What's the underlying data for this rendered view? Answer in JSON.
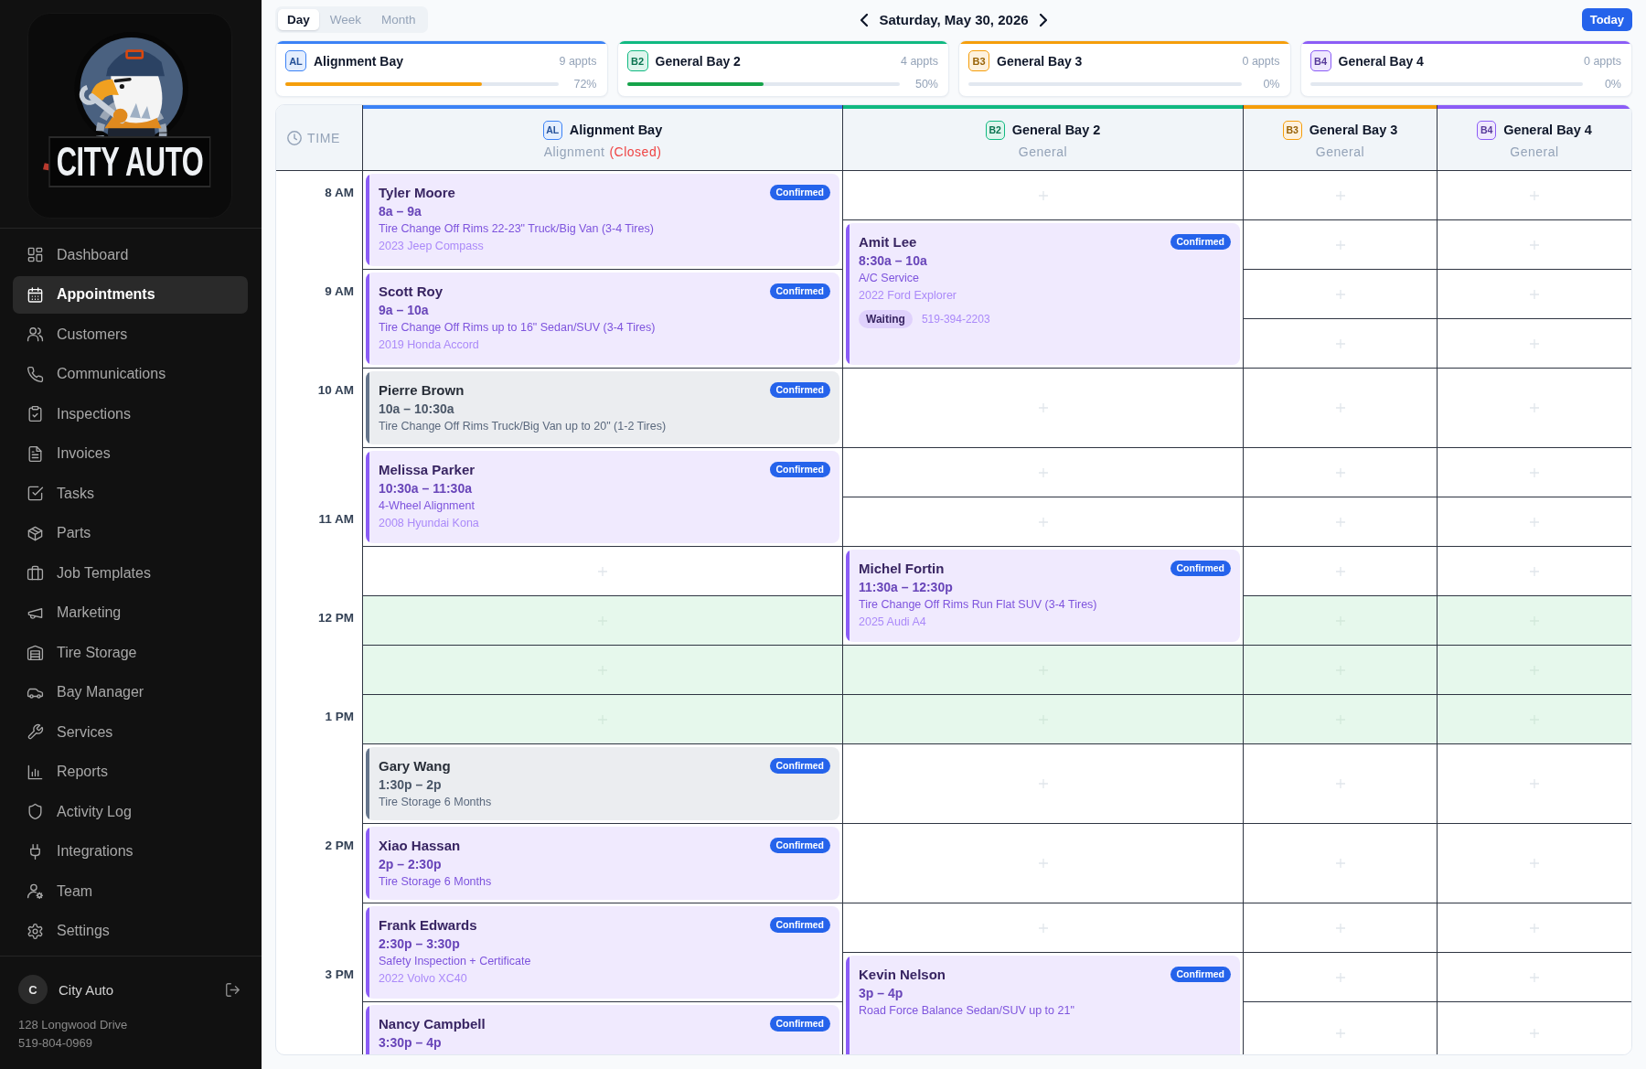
{
  "sidebar": {
    "logo": {
      "text": "CITY AUTO"
    },
    "nav": [
      {
        "label": "Dashboard",
        "selected": false
      },
      {
        "label": "Appointments",
        "selected": true
      },
      {
        "label": "Customers",
        "selected": false
      },
      {
        "label": "Communications",
        "selected": false
      },
      {
        "label": "Inspections",
        "selected": false
      },
      {
        "label": "Invoices",
        "selected": false
      },
      {
        "label": "Tasks",
        "selected": false
      },
      {
        "label": "Parts",
        "selected": false
      },
      {
        "label": "Job Templates",
        "selected": false
      },
      {
        "label": "Marketing",
        "selected": false
      },
      {
        "label": "Tire Storage",
        "selected": false
      },
      {
        "label": "Bay Manager",
        "selected": false
      },
      {
        "label": "Services",
        "selected": false
      },
      {
        "label": "Reports",
        "selected": false
      },
      {
        "label": "Activity Log",
        "selected": false
      },
      {
        "label": "Integrations",
        "selected": false
      },
      {
        "label": "Team",
        "selected": false
      },
      {
        "label": "Settings",
        "selected": false
      }
    ],
    "account": {
      "avatar": "C",
      "name": "City Auto",
      "address": "128 Longwood Drive",
      "phone": "519-804-0969"
    }
  },
  "toolbar": {
    "views": [
      {
        "label": "Day",
        "selected": true
      },
      {
        "label": "Week",
        "selected": false
      },
      {
        "label": "Month",
        "selected": false
      }
    ],
    "date": "Saturday, May 30, 2026",
    "today_button": "Today"
  },
  "bay_summary": [
    {
      "code": "AL",
      "name": "Alignment Bay",
      "appts": "9 appts",
      "level": 0.72,
      "percent": "72%",
      "color": "#3b82f6"
    },
    {
      "code": "B2",
      "name": "General Bay 2",
      "appts": "4 appts",
      "level": 0.5,
      "percent": "50%",
      "color": "#10b981"
    },
    {
      "code": "B3",
      "name": "General Bay 3",
      "appts": "0 appts",
      "level": 0,
      "percent": "0%",
      "color": "#f59e0b"
    },
    {
      "code": "B4",
      "name": "General Bay 4",
      "appts": "0 appts",
      "level": 0,
      "percent": "0%",
      "color": "#8b5cf6"
    }
  ],
  "schedule": {
    "time_header": "TIME",
    "time_slots": [
      {
        "label": "8 AM",
        "lunch": false
      },
      {
        "lunch": false
      },
      {
        "label": "9 AM",
        "lunch": false
      },
      {
        "lunch": false
      },
      {
        "label": "10 AM",
        "lunch": false
      },
      {
        "lunch": false
      },
      {
        "label": "11 AM",
        "lunch": false
      },
      {
        "lunch": false
      },
      {
        "label": "12 PM",
        "lunch": true
      },
      {
        "lunch": true
      },
      {
        "label": "1 PM",
        "lunch": true
      },
      {
        "lunch": false
      },
      {
        "label": "2 PM",
        "lunch": false
      },
      {
        "lunch": false
      },
      {
        "label": "3 PM",
        "lunch": false
      },
      {
        "lunch": false
      }
    ],
    "columns": [
      {
        "code": "AL",
        "name": "Alignment Bay",
        "type": "Alignment",
        "status": "(Closed)",
        "color": "#3b82f6",
        "slots": [
          {
            "kind": "appointment",
            "customer": "Tyler Moore",
            "time": "8a – 9a",
            "service": "Tire Change Off Rims 22-23\" Truck/Big Van (3-4 Tires)",
            "vehicle": "2023 Jeep Compass",
            "status": "Confirmed",
            "color": "#8b5cf6"
          },
          {
            "kind": "continued"
          },
          {
            "kind": "appointment",
            "customer": "Scott Roy",
            "time": "9a – 10a",
            "service": "Tire Change Off Rims up to 16\" Sedan/SUV (3-4 Tires)",
            "vehicle": "2019 Honda Accord",
            "status": "Confirmed",
            "color": "#8b5cf6"
          },
          {
            "kind": "continued"
          },
          {
            "kind": "appointment",
            "customer": "Pierre Brown",
            "time": "10a – 10:30a",
            "service": "Tire Change Off Rims Truck/Big Van up to 20\" (1-2 Tires)",
            "status": "Confirmed",
            "color": "#64748b"
          },
          {
            "kind": "appointment",
            "customer": "Melissa Parker",
            "time": "10:30a – 11:30a",
            "service": "4-Wheel Alignment",
            "vehicle": "2008 Hyundai Kona",
            "status": "Confirmed",
            "color": "#8b5cf6"
          },
          {
            "kind": "continued"
          },
          {
            "kind": "empty"
          },
          {
            "kind": "empty"
          },
          {
            "kind": "empty"
          },
          {
            "kind": "empty"
          },
          {
            "kind": "appointment",
            "customer": "Gary Wang",
            "time": "1:30p – 2p",
            "service": "Tire Storage 6 Months",
            "status": "Confirmed",
            "color": "#64748b"
          },
          {
            "kind": "appointment",
            "customer": "Xiao Hassan",
            "time": "2p – 2:30p",
            "service": "Tire Storage 6 Months",
            "status": "Confirmed",
            "color": "#8b5cf6"
          },
          {
            "kind": "appointment",
            "customer": "Frank Edwards",
            "time": "2:30p – 3:30p",
            "service": "Safety Inspection + Certificate",
            "vehicle": "2022 Volvo XC40",
            "status": "Confirmed",
            "color": "#8b5cf6"
          },
          {
            "kind": "continued"
          },
          {
            "kind": "appointment",
            "customer": "Nancy Campbell",
            "time": "3:30p – 4p",
            "status": "Confirmed",
            "color": "#8b5cf6"
          }
        ]
      },
      {
        "code": "B2",
        "name": "General Bay 2",
        "type": "General",
        "color": "#10b981",
        "slots": [
          {
            "kind": "empty"
          },
          {
            "kind": "appointment",
            "customer": "Amit Lee",
            "time": "8:30a – 10a",
            "service": "A/C Service",
            "vehicle": "2022 Ford Explorer",
            "tag": "Waiting",
            "phone": "519-394-2203",
            "status": "Confirmed",
            "color": "#8b5cf6"
          },
          {
            "kind": "continued"
          },
          {
            "kind": "continued"
          },
          {
            "kind": "empty"
          },
          {
            "kind": "empty"
          },
          {
            "kind": "empty"
          },
          {
            "kind": "appointment",
            "customer": "Michel Fortin",
            "time": "11:30a – 12:30p",
            "service": "Tire Change Off Rims Run Flat SUV (3-4 Tires)",
            "vehicle": "2025 Audi A4",
            "status": "Confirmed",
            "color": "#8b5cf6"
          },
          {
            "kind": "continued"
          },
          {
            "kind": "empty"
          },
          {
            "kind": "empty"
          },
          {
            "kind": "empty"
          },
          {
            "kind": "empty"
          },
          {
            "kind": "empty"
          },
          {
            "kind": "appointment",
            "customer": "Kevin Nelson",
            "time": "3p – 4p",
            "service": "Road Force Balance Sedan/SUV up to 21\"",
            "status": "Confirmed",
            "color": "#8b5cf6"
          },
          {
            "kind": "continued"
          }
        ]
      },
      {
        "code": "B3",
        "name": "General Bay 3",
        "type": "General",
        "color": "#f59e0b",
        "slots": [
          {
            "kind": "empty"
          },
          {
            "kind": "empty"
          },
          {
            "kind": "empty"
          },
          {
            "kind": "empty"
          },
          {
            "kind": "empty"
          },
          {
            "kind": "empty"
          },
          {
            "kind": "empty"
          },
          {
            "kind": "empty"
          },
          {
            "kind": "empty"
          },
          {
            "kind": "empty"
          },
          {
            "kind": "empty"
          },
          {
            "kind": "empty"
          },
          {
            "kind": "empty"
          },
          {
            "kind": "empty"
          },
          {
            "kind": "empty"
          },
          {
            "kind": "empty"
          }
        ]
      },
      {
        "code": "B4",
        "name": "General Bay 4",
        "type": "General",
        "color": "#8b5cf6",
        "slots": [
          {
            "kind": "empty"
          },
          {
            "kind": "empty"
          },
          {
            "kind": "empty"
          },
          {
            "kind": "empty"
          },
          {
            "kind": "empty"
          },
          {
            "kind": "empty"
          },
          {
            "kind": "empty"
          },
          {
            "kind": "empty"
          },
          {
            "kind": "empty"
          },
          {
            "kind": "empty"
          },
          {
            "kind": "empty"
          },
          {
            "kind": "empty"
          },
          {
            "kind": "empty"
          },
          {
            "kind": "empty"
          },
          {
            "kind": "empty"
          },
          {
            "kind": "empty"
          }
        ]
      }
    ]
  }
}
